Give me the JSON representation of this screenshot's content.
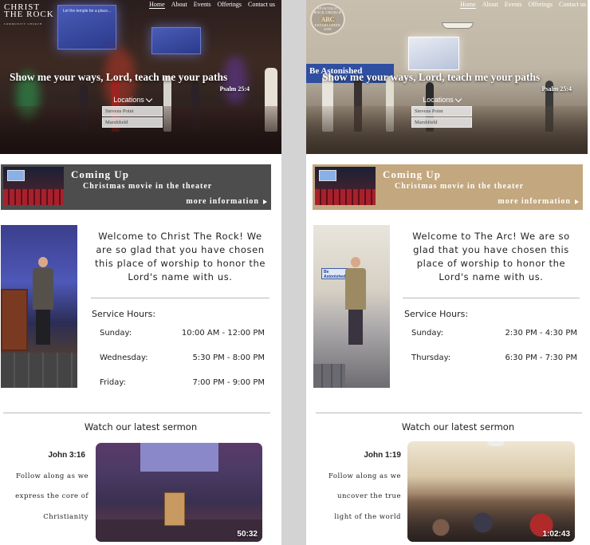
{
  "pages": [
    {
      "logo": {
        "line1": "CHRIST",
        "line2": "THE ROCK",
        "sub": "COMMUNITY CHURCH"
      },
      "nav": [
        "Home",
        "About",
        "Events",
        "Offerings",
        "Contact us"
      ],
      "hero": {
        "verse": "Show me your ways, Lord, teach me your paths",
        "ref": "Psalm 25:4",
        "screen_text": "Let the temple be a place..."
      },
      "locations": {
        "label": "Locations",
        "items": [
          "Stevens Point",
          "Marshfield"
        ]
      },
      "coming_up": {
        "title": "Coming Up",
        "subtitle": "Christmas movie in the theater",
        "more": "more information"
      },
      "welcome": "Welcome to Christ The Rock! We are so glad that you have chosen this place of worship to honor the Lord's name with us.",
      "service": {
        "title": "Service Hours:",
        "rows": [
          {
            "day": "Sunday:",
            "time": "10:00 AM - 12:00 PM"
          },
          {
            "day": "Wednesday:",
            "time": "5:30 PM - 8:00 PM"
          },
          {
            "day": "Friday:",
            "time": "7:00 PM - 9:00 PM"
          }
        ]
      },
      "sermon": {
        "heading": "Watch our latest sermon",
        "ref": "John 3:16",
        "lines": [
          "Follow along as we",
          "express the core of",
          "Christianity"
        ],
        "duration": "50:32"
      }
    },
    {
      "logo": {
        "ring_top": "APOSTOLIC ROCK CHURCH",
        "center": "ARC",
        "ring_bottom": "ESTABLISHED 2008"
      },
      "nav": [
        "Home",
        "About",
        "Events",
        "Offerings",
        "Contact us"
      ],
      "hero": {
        "verse": "Show me your ways, Lord, teach me your paths",
        "ref": "Psalm 25:4",
        "banner": "Be Astonished"
      },
      "locations": {
        "label": "Locations",
        "items": [
          "Stevens Point",
          "Marshfield"
        ]
      },
      "coming_up": {
        "title": "Coming Up",
        "subtitle": "Christmas movie in the theater",
        "more": "more information"
      },
      "welcome": "Welcome to The Arc! We are so glad that you have chosen this place of worship to honor the Lord's name with us.",
      "service": {
        "title": "Service Hours:",
        "rows": [
          {
            "day": "Sunday:",
            "time": "2:30 PM - 4:30 PM"
          },
          {
            "day": "Thursday:",
            "time": "6:30 PM - 7:30 PM"
          }
        ]
      },
      "photo_sign": "Be Astonished",
      "sermon": {
        "heading": "Watch our latest sermon",
        "ref": "John 1:19",
        "lines": [
          "Follow along as we",
          "uncover the true",
          "light of the world"
        ],
        "duration": "1:02:43"
      }
    }
  ],
  "colors": {
    "left_banner": "#4d4d4d",
    "right_banner": "#c3a77f",
    "divider": "#d3d3d3"
  }
}
